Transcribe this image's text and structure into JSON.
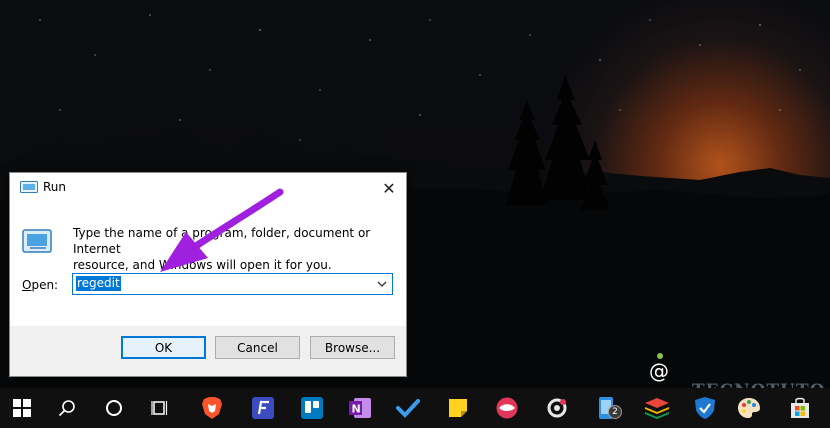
{
  "dialog": {
    "title": "Run",
    "close_glyph": "✕",
    "description_line1": "Type the name of a program, folder, document or Internet",
    "description_line2": "resource, and Windows will open it for you.",
    "open_label_prefix": "O",
    "open_label_rest": "pen:",
    "open_value": "regedit",
    "ok_label": "OK",
    "cancel_label": "Cancel",
    "browse_label": "Browse...",
    "accent_color": "#0078d7"
  },
  "watermark": "TECNOTUTO",
  "taskbar": {
    "background": "#101010",
    "items": [
      {
        "icon": "windows-start-icon"
      },
      {
        "icon": "search-icon"
      },
      {
        "icon": "cortana-icon"
      },
      {
        "icon": "task-view-icon"
      },
      {
        "icon": "brave-icon"
      },
      {
        "icon": "files-app-icon"
      },
      {
        "icon": "trello-icon"
      },
      {
        "icon": "onenote-icon"
      },
      {
        "icon": "todo-icon"
      },
      {
        "icon": "sticky-notes-icon"
      },
      {
        "icon": "lips-app-icon"
      },
      {
        "icon": "settings-app-icon"
      },
      {
        "icon": "phone-app-icon",
        "badge": "2"
      },
      {
        "icon": "stack-app-icon"
      },
      {
        "icon": "defender-icon"
      },
      {
        "icon": "paint-icon"
      },
      {
        "icon": "store-icon"
      }
    ]
  }
}
